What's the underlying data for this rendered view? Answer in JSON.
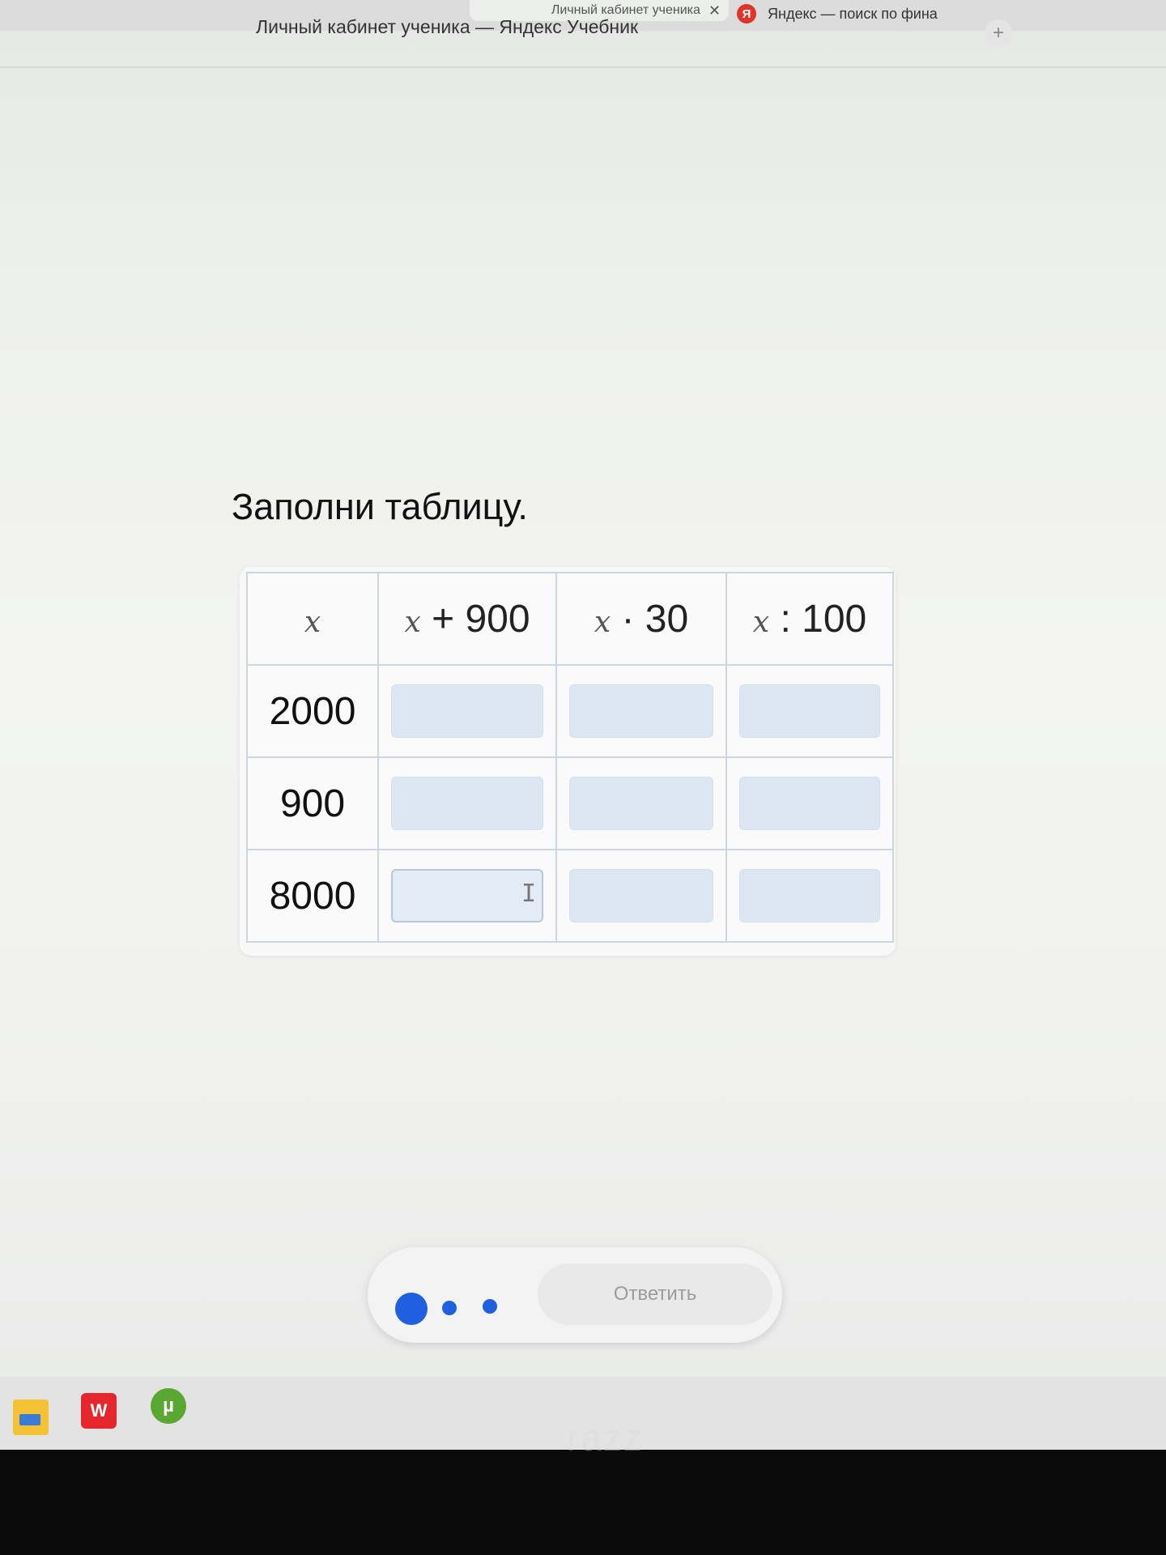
{
  "browser": {
    "active_tab_title": "Личный кабинет ученика",
    "inactive_tab_title": "Яндекс — поиск по фина",
    "yandex_icon_letter": "Я",
    "window_title": "Личный кабинет ученика — Яндекс Учебник"
  },
  "task": {
    "heading": "Заполни таблицу.",
    "table": {
      "headers": [
        {
          "var": "x",
          "op": ""
        },
        {
          "var": "x",
          "op": " + 900"
        },
        {
          "var": "x",
          "op": " · 30"
        },
        {
          "var": "x",
          "op": " : 100"
        }
      ],
      "rows": [
        {
          "label": "2000",
          "cells": [
            "",
            "",
            ""
          ]
        },
        {
          "label": "900",
          "cells": [
            "",
            "",
            ""
          ]
        },
        {
          "label": "8000",
          "cells": [
            "",
            "",
            ""
          ]
        }
      ]
    }
  },
  "bottom_bar": {
    "progress_steps": 3,
    "current_step": 1,
    "submit_label": "Ответить"
  },
  "taskbar": {
    "icons": [
      "folder-icon",
      "wps-office-icon",
      "utorrent-icon"
    ],
    "wps_letter": "W",
    "utorrent_letter": "µ"
  },
  "monitor": {
    "brand": "razz"
  }
}
